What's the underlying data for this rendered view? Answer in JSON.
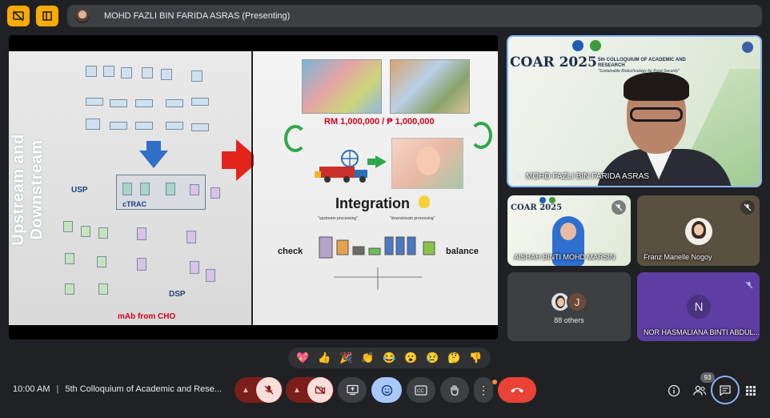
{
  "topbar": {
    "presenter_label": "MOHD FAZLI BIN FARIDA ASRAS (Presenting)"
  },
  "slide": {
    "vertical_title": "Upstream and Downstream",
    "usp_label": "USP",
    "ctrac_label": "cTRAC",
    "dsp_label": "DSP",
    "mab_label": "mAb from CHO",
    "price_label": "RM 1,000,000 / ₱ 1,000,000",
    "integration_label": "Integration",
    "check_label": "check",
    "balance_label": "balance",
    "upstream_processing": "\"upstream processing\"",
    "downstream_processing": "\"downstream processing\""
  },
  "participants": {
    "main": {
      "name": "MOHD FAZLI BIN FARIDA ASRAS",
      "banner_title": "COAR 2025",
      "banner_sub": "5th COLLOQUIUM OF ACADEMIC AND RESEARCH",
      "banner_tag": "\"Sustainable Biotechnology for Food Security\""
    },
    "aishah": {
      "name": "AISHAH BINTI MOHD MARSIN",
      "banner_title": "COAR 2025"
    },
    "franz": {
      "name": "Franz Marielle Nogoy"
    },
    "others": {
      "label": "88 others",
      "avatar_letter": "J"
    },
    "nor": {
      "name": "NOR HASMALIANA BINTI ABDUL...",
      "avatar_letter": "N"
    }
  },
  "reactions": [
    "💖",
    "👍",
    "🎉",
    "👏",
    "😂",
    "😮",
    "😢",
    "🤔",
    "👎"
  ],
  "bottombar": {
    "time": "10:00 AM",
    "separator": "|",
    "meeting_title": "5th Colloquium of Academic and Rese...",
    "people_count": "93"
  },
  "colors": {
    "accent_blue": "#8ab4f8",
    "end_call_red": "#ea4335",
    "presenter_yellow": "#f9ab00",
    "nor_tile_purple": "#5e3ea3"
  }
}
